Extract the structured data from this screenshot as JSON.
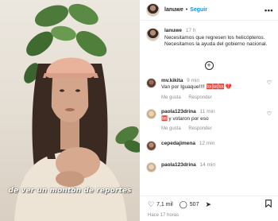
{
  "video": {
    "caption": "de ver un montón de reportes"
  },
  "header": {
    "username": "lanuwe",
    "separator": "•",
    "follow_label": "Seguir",
    "more_icon": "more-horizontal-icon"
  },
  "post": {
    "username": "lanuwe",
    "time": "17 h",
    "text": "Necesitamos que regresen los helicópteros. Necesitamos la ayuda del gobierno nacional.",
    "add_icon": "plus-circle-icon"
  },
  "comments": [
    {
      "username": "mv.kikita",
      "time": "9 min",
      "text": "Van por Iguaque!!!!",
      "emojis": "🆘🆘🆘 💔",
      "likes_label": "Me gusta",
      "reply_label": "Responder"
    },
    {
      "username": "paola123drina",
      "time": "11 min",
      "text": "y votaron por eso",
      "emojis": "🆘",
      "likes_label": "Me gusta",
      "reply_label": "Responder"
    },
    {
      "username": "cepedajimena",
      "time": "12 min",
      "text": "",
      "emojis": "",
      "likes_label": "",
      "reply_label": ""
    },
    {
      "username": "paola123drina",
      "time": "14 min",
      "text": "",
      "emojis": "",
      "likes_label": "",
      "reply_label": ""
    }
  ],
  "footer": {
    "likes_count": "7,1 mil",
    "comments_count": "507",
    "posted_ago": "Hace 17 horas",
    "icons": [
      "heart-icon",
      "comment-icon",
      "share-icon",
      "bookmark-icon"
    ]
  },
  "colors": {
    "link_blue": "#0095f6",
    "text": "#262626",
    "muted": "#8e8e8e",
    "emoji_red": "#ed4956"
  }
}
